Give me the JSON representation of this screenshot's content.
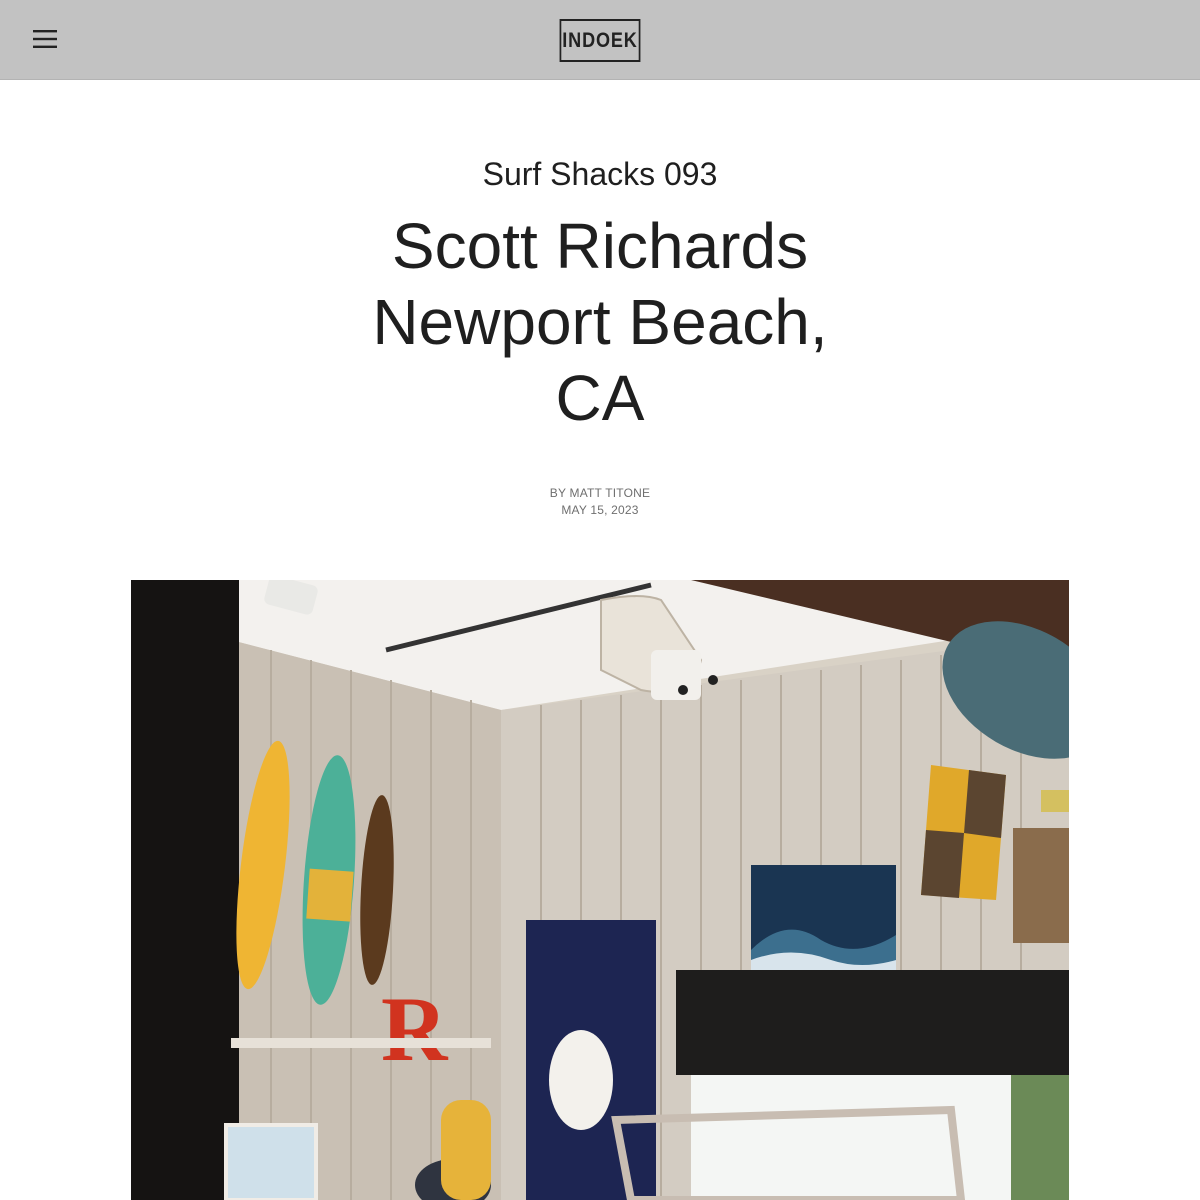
{
  "header": {
    "menu_icon": "hamburger-menu-icon",
    "logo_text": "INDOEK"
  },
  "article": {
    "kicker": "Surf Shacks 093",
    "title": "Scott Richards Newport Beach, CA",
    "author": "BY MATT TITONE",
    "date": "MAY 15, 2023"
  },
  "hero_image": {
    "description_visible": false,
    "sign_letter": "R"
  },
  "colors": {
    "header_bg": "#c2c2c2",
    "text": "#1f1f1f",
    "meta": "#6f6f6f"
  }
}
